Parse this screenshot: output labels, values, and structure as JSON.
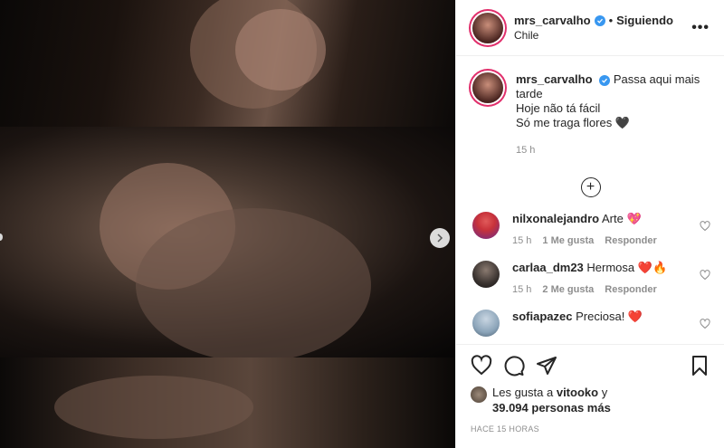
{
  "post": {
    "author": {
      "username": "mrs_carvalho",
      "follow_state": "Siguiendo",
      "location": "Chile"
    },
    "caption": {
      "lines": [
        "Passa aqui mais tarde",
        "Hoje não tá fácil",
        "Só me traga flores 🖤"
      ],
      "time": "15 h"
    },
    "comments": [
      {
        "username": "nilxonalejandro",
        "text": "Arte 💖",
        "time": "15 h",
        "likes": "1 Me gusta",
        "reply": "Responder",
        "avatar_color": "#c8323a"
      },
      {
        "username": "carlaa_dm23",
        "text": "Hermosa ❤️🔥",
        "time": "15 h",
        "likes": "2 Me gusta",
        "reply": "Responder",
        "avatar_color": "#3a3330"
      },
      {
        "username": "sofiapazec",
        "text": "Preciosa! ❤️",
        "avatar_color": "#8aa3b8"
      }
    ],
    "likes": {
      "prefix": "Les gusta a",
      "first_user": "vitooko",
      "suffix": "y",
      "others": "39.094 personas más"
    },
    "timestamp": "HACE 15 HORAS",
    "icons": [
      "heart-icon",
      "comment-icon",
      "share-icon",
      "bookmark-icon",
      "more-icon",
      "add-circle-icon",
      "chevron-right-icon",
      "verified-icon"
    ]
  }
}
